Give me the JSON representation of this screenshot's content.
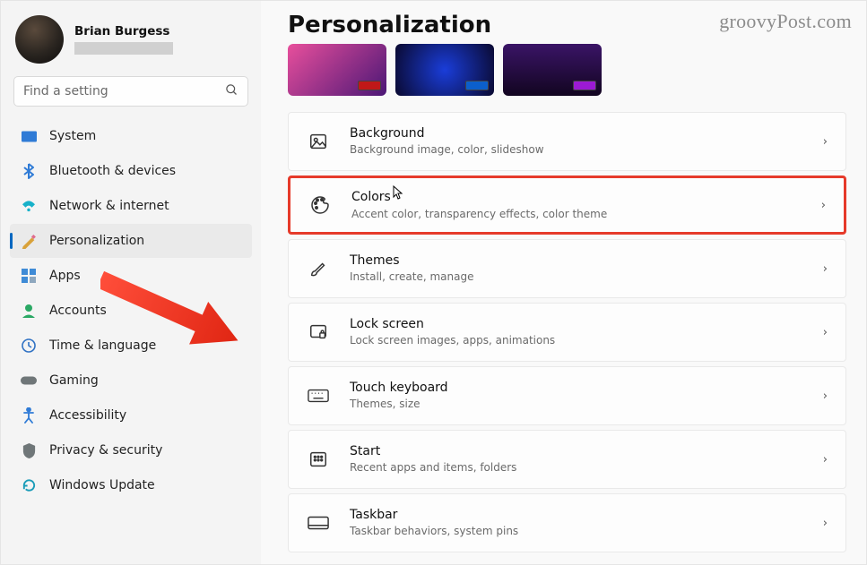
{
  "user": {
    "name": "Brian Burgess"
  },
  "search": {
    "placeholder": "Find a setting"
  },
  "sidebar": {
    "items": [
      {
        "label": "System"
      },
      {
        "label": "Bluetooth & devices"
      },
      {
        "label": "Network & internet"
      },
      {
        "label": "Personalization"
      },
      {
        "label": "Apps"
      },
      {
        "label": "Accounts"
      },
      {
        "label": "Time & language"
      },
      {
        "label": "Gaming"
      },
      {
        "label": "Accessibility"
      },
      {
        "label": "Privacy & security"
      },
      {
        "label": "Windows Update"
      }
    ]
  },
  "page": {
    "title": "Personalization"
  },
  "settings": [
    {
      "title": "Background",
      "sub": "Background image, color, slideshow"
    },
    {
      "title": "Colors",
      "sub": "Accent color, transparency effects, color theme"
    },
    {
      "title": "Themes",
      "sub": "Install, create, manage"
    },
    {
      "title": "Lock screen",
      "sub": "Lock screen images, apps, animations"
    },
    {
      "title": "Touch keyboard",
      "sub": "Themes, size"
    },
    {
      "title": "Start",
      "sub": "Recent apps and items, folders"
    },
    {
      "title": "Taskbar",
      "sub": "Taskbar behaviors, system pins"
    }
  ],
  "watermark": "groovyPost.com",
  "chevron": "›"
}
